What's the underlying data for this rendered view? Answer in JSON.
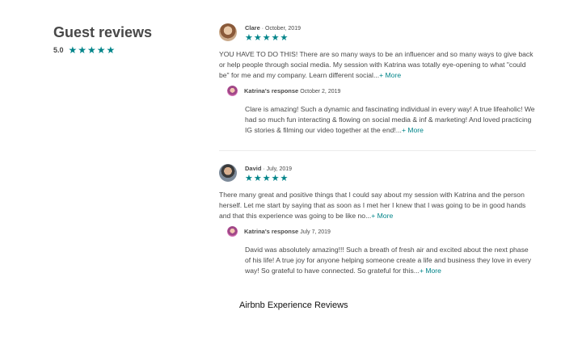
{
  "summary": {
    "heading": "Guest reviews",
    "rating": "5.0",
    "stars": "★★★★★"
  },
  "reviews": [
    {
      "author": "Clare",
      "separator": " · ",
      "date": "October, 2019",
      "stars": "★★★★★",
      "text": "YOU HAVE TO DO THIS! There are so many ways to be an influencer and so many ways to give back or help people through social media. My session with Katrina was totally eye-opening to what \"could be\" for me and my company. Learn different social...",
      "more_label": "+ More",
      "response": {
        "author": "Katrina's response",
        "date": "October 2, 2019",
        "text": "Clare is amazing! Such a dynamic and fascinating individual in every way! A true lifeaholic! We had so much fun interacting & flowing on social media & inf & marketing! And loved practicing IG stories & filming our video together at the end!...",
        "more_label": "+ More"
      }
    },
    {
      "author": "David",
      "separator": " · ",
      "date": "July, 2019",
      "stars": "★★★★★",
      "text": "There many great and positive things that I could say about my session with Katrina and the person herself. Let me start by saying that as soon as I met her I knew that I was going to be in good hands and that this experience was going to be like no...",
      "more_label": "+ More",
      "response": {
        "author": "Katrina's response",
        "date": "July 7, 2019",
        "text": "David was absolutely amazing!!! Such a breath of fresh air and excited about the next phase of his life! A true joy for anyone helping someone create a life and business they love in every way! So grateful to have connected. So grateful for this...",
        "more_label": "+ More"
      }
    }
  ],
  "caption": "Airbnb Experience Reviews",
  "colors": {
    "accent": "#008489",
    "text": "#484848",
    "divider": "#ebebeb"
  }
}
